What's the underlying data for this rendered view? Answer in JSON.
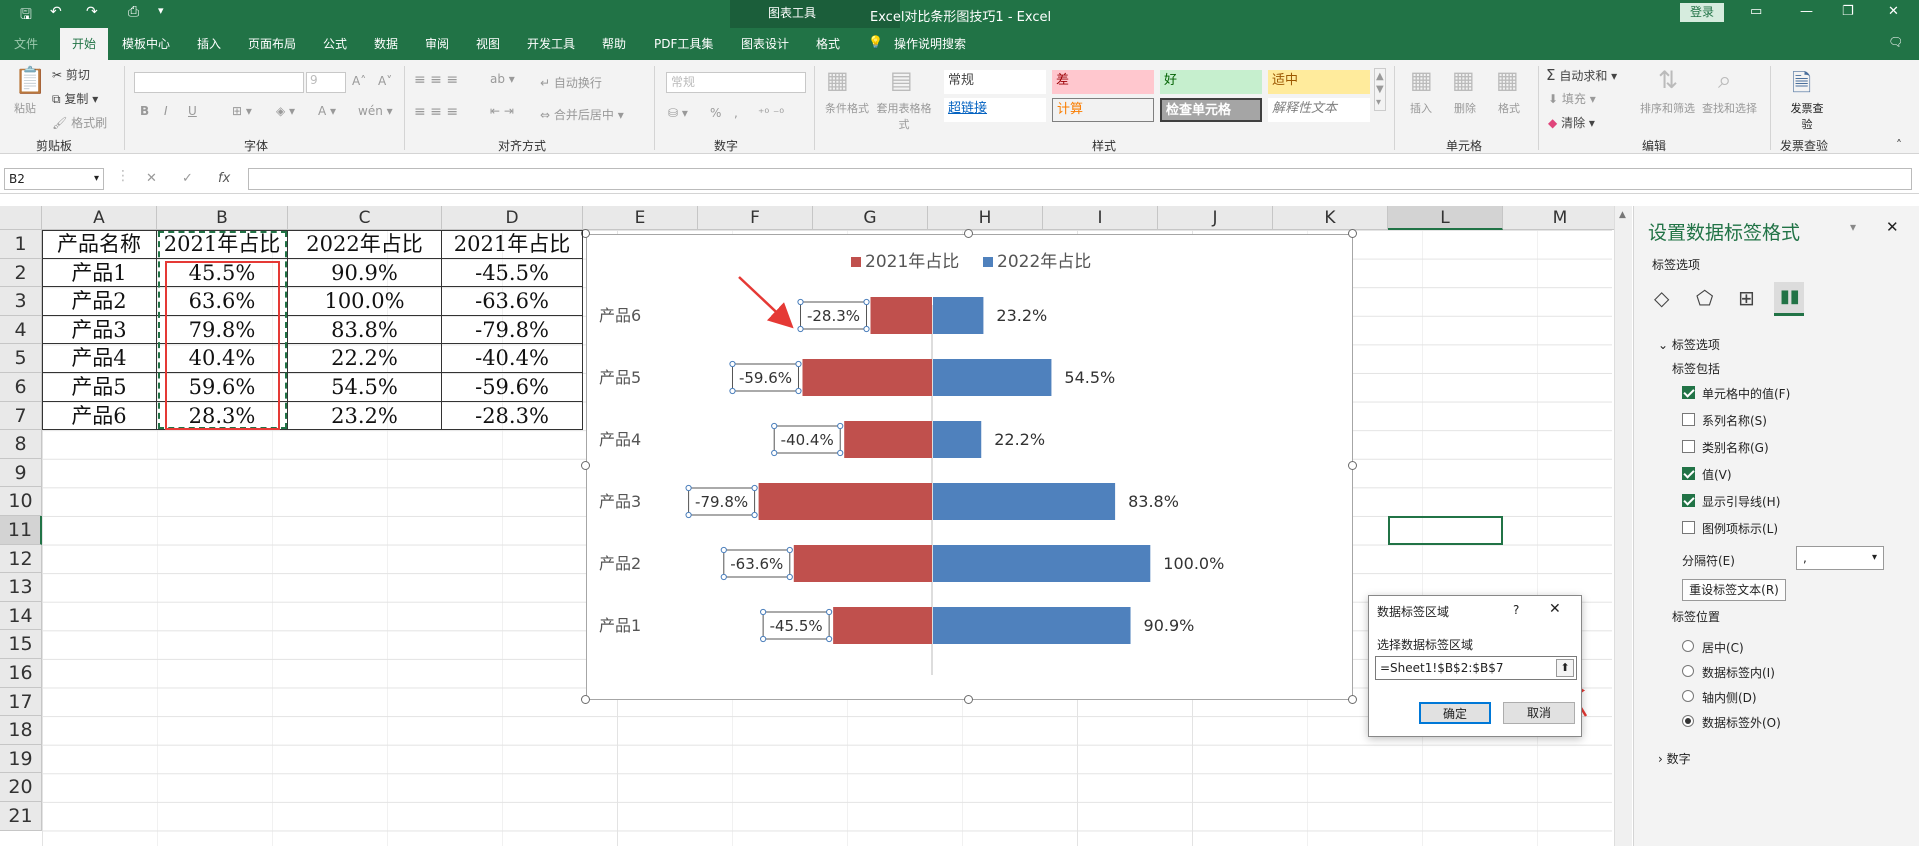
{
  "app": {
    "title": "Excel对比条形图技巧1 - Excel",
    "context_tab_title": "图表工具",
    "login_label": "登录"
  },
  "ribbon_tabs": [
    "文件",
    "开始",
    "模板中心",
    "插入",
    "页面布局",
    "公式",
    "数据",
    "审阅",
    "视图",
    "开发工具",
    "帮助",
    "PDF工具集",
    "图表设计",
    "格式"
  ],
  "tell_me": "操作说明搜索",
  "ribbon": {
    "clipboard": {
      "paste": "粘贴",
      "cut": "剪切",
      "copy": "复制",
      "format_painter": "格式刷",
      "label": "剪贴板"
    },
    "font": {
      "size": "9",
      "bold": "B",
      "italic": "I",
      "underline": "U",
      "label": "字体"
    },
    "alignment": {
      "wrap": "自动换行",
      "merge": "合并后居中",
      "label": "对齐方式"
    },
    "number": {
      "format": "常规",
      "percent": "%",
      "label": "数字"
    },
    "styles": {
      "conditional": "条件格式",
      "table": "套用表格格式",
      "cells": [
        "常规",
        "差",
        "好",
        "适中",
        "超链接",
        "计算",
        "检查单元格",
        "解释性文本"
      ],
      "label": "样式"
    },
    "cells_group": {
      "insert": "插入",
      "delete": "删除",
      "format": "格式",
      "label": "单元格"
    },
    "editing": {
      "autosum": "自动求和",
      "fill": "填充",
      "clear": "清除",
      "sort": "排序和筛选",
      "find": "查找和选择",
      "label": "编辑"
    },
    "invoice": {
      "check": "发票查验",
      "label": "发票查验"
    }
  },
  "formula_bar": {
    "name_box": "B2",
    "fx": "fx",
    "cancel": "✕",
    "enter": "✓"
  },
  "columns": [
    "A",
    "B",
    "C",
    "D",
    "E",
    "F",
    "G",
    "H",
    "I",
    "J",
    "K",
    "L",
    "M"
  ],
  "rows": [
    "1",
    "2",
    "3",
    "4",
    "5",
    "6",
    "7",
    "8",
    "9",
    "10",
    "11",
    "12",
    "13",
    "14",
    "15",
    "16",
    "17",
    "18",
    "19",
    "20",
    "21"
  ],
  "table": {
    "headers": [
      "产品名称",
      "2021年占比",
      "2022年占比",
      "2021年占比"
    ],
    "rows": [
      [
        "产品1",
        "45.5%",
        "90.9%",
        "-45.5%"
      ],
      [
        "产品2",
        "63.6%",
        "100.0%",
        "-63.6%"
      ],
      [
        "产品3",
        "79.8%",
        "83.8%",
        "-79.8%"
      ],
      [
        "产品4",
        "40.4%",
        "22.2%",
        "-40.4%"
      ],
      [
        "产品5",
        "59.6%",
        "54.5%",
        "-59.6%"
      ],
      [
        "产品6",
        "28.3%",
        "23.2%",
        "-28.3%"
      ]
    ]
  },
  "chart_data": {
    "type": "bar",
    "orientation": "horizontal",
    "categories": [
      "产品6",
      "产品5",
      "产品4",
      "产品3",
      "产品2",
      "产品1"
    ],
    "series": [
      {
        "name": "2021年占比",
        "values": [
          -28.3,
          -59.6,
          -40.4,
          -79.8,
          -63.6,
          -45.5
        ],
        "labels": [
          "-28.3%",
          "-59.6%",
          "-40.4%",
          "-79.8%",
          "-63.6%",
          "-45.5%"
        ],
        "color": "#c0504d"
      },
      {
        "name": "2022年占比",
        "values": [
          23.2,
          54.5,
          22.2,
          83.8,
          100.0,
          90.9
        ],
        "labels": [
          "23.2%",
          "54.5%",
          "22.2%",
          "83.8%",
          "100.0%",
          "90.9%"
        ],
        "color": "#4f81bd"
      }
    ],
    "xlim": [
      -100,
      100
    ],
    "legend": "top",
    "grid": false
  },
  "panel": {
    "title": "设置数据标签格式",
    "subtitle": "标签选项",
    "section": "标签选项",
    "includes_label": "标签包括",
    "checks": [
      {
        "label": "单元格中的值(F)",
        "checked": true
      },
      {
        "label": "系列名称(S)",
        "checked": false
      },
      {
        "label": "类别名称(G)",
        "checked": false
      },
      {
        "label": "值(V)",
        "checked": true
      },
      {
        "label": "显示引导线(H)",
        "checked": true
      },
      {
        "label": "图例项标示(L)",
        "checked": false
      }
    ],
    "separator_label": "分隔符(E)",
    "separator_value": ",",
    "reset_button": "重设标签文本(R)",
    "position_label": "标签位置",
    "positions": [
      {
        "label": "居中(C)",
        "selected": false
      },
      {
        "label": "数据标签内(I)",
        "selected": false
      },
      {
        "label": "轴内侧(D)",
        "selected": false
      },
      {
        "label": "数据标签外(O)",
        "selected": true
      }
    ],
    "number_section": "数字"
  },
  "dialog": {
    "title": "数据标签区域",
    "help": "?",
    "prompt": "选择数据标签区域",
    "value": "=Sheet1!$B$2:$B$7",
    "ok": "确定",
    "cancel": "取消"
  },
  "colors": {
    "excel_green": "#217346",
    "red_series": "#c0504d",
    "blue_series": "#4f81bd",
    "annotation_red": "#e53935"
  }
}
